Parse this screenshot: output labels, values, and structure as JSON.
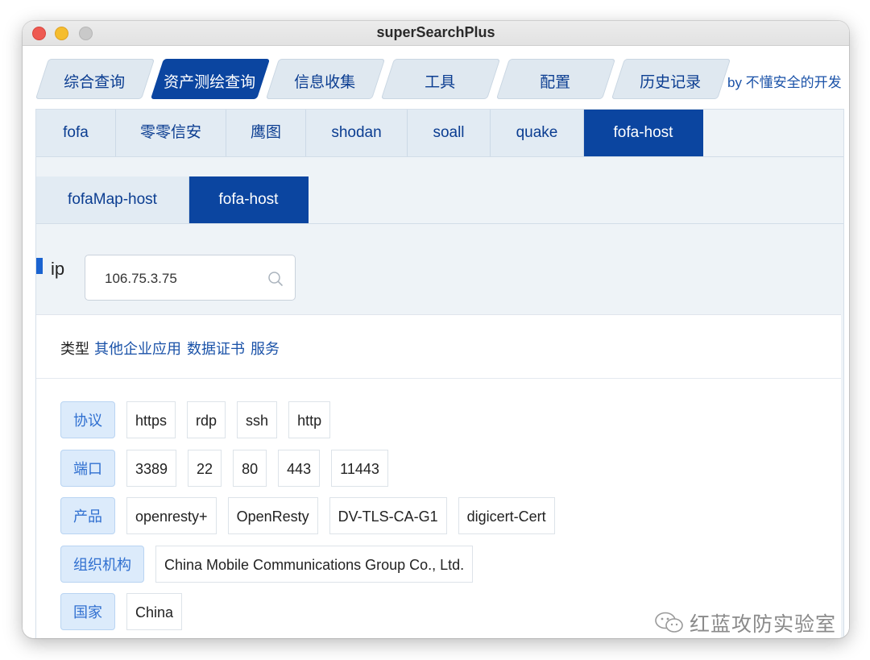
{
  "window": {
    "title": "superSearchPlus"
  },
  "main_tabs": [
    {
      "label": "综合查询",
      "active": false
    },
    {
      "label": "资产测绘查询",
      "active": true
    },
    {
      "label": "信息收集",
      "active": false
    },
    {
      "label": "工具",
      "active": false
    },
    {
      "label": "配置",
      "active": false
    },
    {
      "label": "历史记录",
      "active": false
    }
  ],
  "author": "by 不懂安全的开发",
  "sub_tabs": [
    {
      "label": "fofa",
      "active": false
    },
    {
      "label": "零零信安",
      "active": false
    },
    {
      "label": "鹰图",
      "active": false
    },
    {
      "label": "shodan",
      "active": false
    },
    {
      "label": "soall",
      "active": false
    },
    {
      "label": "quake",
      "active": false
    },
    {
      "label": "fofa-host",
      "active": true
    }
  ],
  "sub_tabs2": [
    {
      "label": "fofaMap-host",
      "active": false
    },
    {
      "label": "fofa-host",
      "active": true
    }
  ],
  "ip": {
    "label": "ip",
    "value": "106.75.3.75"
  },
  "type_row": {
    "label": "类型",
    "links": [
      "其他企业应用",
      "数据证书",
      "服务"
    ]
  },
  "rows": [
    {
      "label": "协议",
      "chips": [
        "https",
        "rdp",
        "ssh",
        "http"
      ]
    },
    {
      "label": "端口",
      "chips": [
        "3389",
        "22",
        "80",
        "443",
        "11443"
      ]
    },
    {
      "label": "产品",
      "chips": [
        "openresty+",
        "OpenResty",
        "DV-TLS-CA-G1",
        "digicert-Cert"
      ]
    },
    {
      "label": "组织机构",
      "chips": [
        "China Mobile Communications Group Co., Ltd."
      ]
    },
    {
      "label": "国家",
      "chips": [
        "China"
      ]
    }
  ],
  "watermark": {
    "text": "红蓝攻防实验室",
    "icon": "wechat-icon"
  },
  "colors": {
    "accent": "#0b45a0",
    "tab_bg": "#dfe8f0",
    "label_bg": "#dcebfb"
  }
}
